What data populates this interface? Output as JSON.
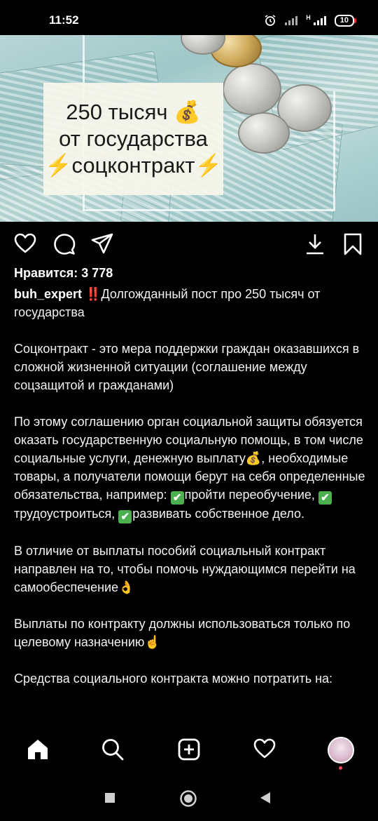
{
  "status_bar": {
    "time": "11:52",
    "network_label": "H",
    "battery": "10"
  },
  "post": {
    "image": {
      "title_line1": "250 тысяч",
      "title_emoji1": "💰",
      "title_line2": "от государства",
      "title_line3": "соцконтракт",
      "title_emoji_lightning": "⚡"
    },
    "likes": "Нравится: 3 778",
    "username": "buh_expert",
    "caption_intro_emoji": "‼️",
    "caption_intro": "Долгожданный пост про 250 тысяч от государства",
    "p2": "Соцконтракт - это мера поддержки граждан оказавшихся в сложной жизненной ситуации (соглашение между соцзащитой и гражданами)",
    "p3_start": "По этому соглашению орган социальной защиты обязуется оказать государственную социальную помощь, в том числе социальные услуги, денежную выплату",
    "p3_money_emoji": "💰",
    "p3_middle": ", необходимые товары, а получатели помощи берут на себя определенные обязательства, например: ",
    "check_mark": "✔",
    "p3_item1": "пройти переобучение, ",
    "p3_item2": "трудоустроиться, ",
    "p3_item3": "развивать собственное дело.",
    "p4": "В отличие от выплаты пособий социальный контракт направлен на то, чтобы помочь нуждающимся перейти на самообеспечение",
    "p4_emoji": "👌",
    "p5": "Выплаты по контракту должны использоваться только по целевому назначению",
    "p5_emoji": "☝",
    "p6": "Средства социального контракта можно потратить на:"
  },
  "icons": {
    "action_bar": [
      "heart-icon",
      "comment-icon",
      "share-icon",
      "download-icon",
      "bookmark-icon"
    ],
    "bottom_nav": [
      "home-icon",
      "search-icon",
      "add-post-icon",
      "activity-heart-icon",
      "profile-avatar"
    ],
    "system_nav": [
      "recents-square-icon",
      "home-circle-icon",
      "back-triangle-icon"
    ]
  },
  "colors": {
    "background": "#000000",
    "text": "#f5f5f5",
    "notification_dot": "#ed4956",
    "check_green": "#4caf50"
  }
}
